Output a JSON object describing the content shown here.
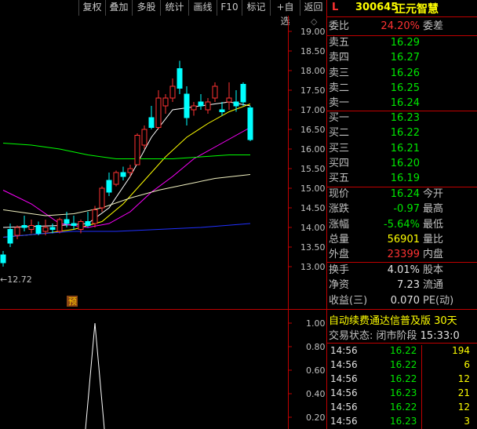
{
  "toolbar": [
    "复权",
    "叠加",
    "多股",
    "统计",
    "画线",
    "F10",
    "标记",
    "+自选",
    "返回"
  ],
  "price_axis": [
    "19.00",
    "18.50",
    "18.00",
    "17.50",
    "17.00",
    "16.50",
    "16.00",
    "15.50",
    "15.00",
    "14.50",
    "14.00",
    "13.50",
    "13.00"
  ],
  "volume_axis": [
    "1.00",
    "0.80",
    "0.60",
    "0.40",
    "0.20"
  ],
  "low_marker": "←12.72",
  "forecast_badge": "预",
  "stock": {
    "flag": "L",
    "code": "300645",
    "name": "正元智慧"
  },
  "weibi": {
    "label": "委比",
    "value": "24.20%",
    "label2": "委差"
  },
  "asks": [
    {
      "label": "卖五",
      "price": "16.29"
    },
    {
      "label": "卖四",
      "price": "16.27"
    },
    {
      "label": "卖三",
      "price": "16.26"
    },
    {
      "label": "卖二",
      "price": "16.25"
    },
    {
      "label": "卖一",
      "price": "16.24"
    }
  ],
  "bids": [
    {
      "label": "买一",
      "price": "16.23"
    },
    {
      "label": "买二",
      "price": "16.22"
    },
    {
      "label": "买三",
      "price": "16.21"
    },
    {
      "label": "买四",
      "price": "16.20"
    },
    {
      "label": "买五",
      "price": "16.19"
    }
  ],
  "quote": [
    {
      "label": "现价",
      "value": "16.24",
      "label2": "今开",
      "color": "g"
    },
    {
      "label": "涨跌",
      "value": "-0.97",
      "label2": "最高",
      "color": "g"
    },
    {
      "label": "涨幅",
      "value": "-5.64%",
      "label2": "最低",
      "color": "g"
    },
    {
      "label": "总量",
      "value": "56901",
      "label2": "量比",
      "color": "y"
    },
    {
      "label": "外盘",
      "value": "23399",
      "label2": "内盘",
      "color": "r"
    }
  ],
  "stats": [
    {
      "label": "换手",
      "value": "4.01%",
      "label2": "股本"
    },
    {
      "label": "净资",
      "value": "7.23",
      "label2": "流通"
    },
    {
      "label": "收益(三)",
      "value": "0.070",
      "label2": "PE(动)"
    }
  ],
  "info_line1": "自动续费通达信普及版 30天",
  "info_line2_label": "交易状态: 闭市阶段",
  "info_line2_time": "15:33:0",
  "ticks": [
    {
      "time": "14:56",
      "price": "16.22",
      "vol": "194"
    },
    {
      "time": "14:56",
      "price": "16.22",
      "vol": "6"
    },
    {
      "time": "14:56",
      "price": "16.22",
      "vol": "12"
    },
    {
      "time": "14:56",
      "price": "16.23",
      "vol": "21"
    },
    {
      "time": "14:56",
      "price": "16.22",
      "vol": "12"
    },
    {
      "time": "14:56",
      "price": "16.23",
      "vol": "3"
    }
  ],
  "candles": [
    {
      "o": 13.3,
      "h": 13.4,
      "l": 13.0,
      "c": 13.1
    },
    {
      "o": 13.95,
      "h": 14.1,
      "l": 13.5,
      "c": 13.6
    },
    {
      "o": 13.8,
      "h": 14.05,
      "l": 13.7,
      "c": 14.0
    },
    {
      "o": 14.05,
      "h": 14.3,
      "l": 13.9,
      "c": 14.0
    },
    {
      "o": 13.95,
      "h": 14.2,
      "l": 13.85,
      "c": 14.05
    },
    {
      "o": 14.05,
      "h": 14.15,
      "l": 13.8,
      "c": 13.85
    },
    {
      "o": 13.9,
      "h": 14.2,
      "l": 13.8,
      "c": 14.0
    },
    {
      "o": 14.0,
      "h": 14.1,
      "l": 13.85,
      "c": 13.95
    },
    {
      "o": 13.9,
      "h": 14.25,
      "l": 13.85,
      "c": 14.2
    },
    {
      "o": 14.2,
      "h": 14.4,
      "l": 14.0,
      "c": 14.1
    },
    {
      "o": 14.1,
      "h": 14.3,
      "l": 13.95,
      "c": 14.05
    },
    {
      "o": 13.95,
      "h": 14.2,
      "l": 13.85,
      "c": 14.15
    },
    {
      "o": 14.15,
      "h": 14.4,
      "l": 14.0,
      "c": 14.05
    },
    {
      "o": 14.1,
      "h": 14.55,
      "l": 14.0,
      "c": 14.45
    },
    {
      "o": 14.5,
      "h": 15.05,
      "l": 14.4,
      "c": 15.0
    },
    {
      "o": 15.2,
      "h": 15.4,
      "l": 14.8,
      "c": 14.9
    },
    {
      "o": 15.1,
      "h": 15.45,
      "l": 15.05,
      "c": 15.4
    },
    {
      "o": 15.4,
      "h": 15.55,
      "l": 15.2,
      "c": 15.3
    },
    {
      "o": 15.4,
      "h": 15.6,
      "l": 15.3,
      "c": 15.5
    },
    {
      "o": 15.6,
      "h": 16.4,
      "l": 15.6,
      "c": 16.35
    },
    {
      "o": 16.1,
      "h": 16.6,
      "l": 16.0,
      "c": 16.5
    },
    {
      "o": 16.8,
      "h": 17.1,
      "l": 16.5,
      "c": 16.55
    },
    {
      "o": 16.55,
      "h": 17.5,
      "l": 16.5,
      "c": 17.3
    },
    {
      "o": 17.1,
      "h": 17.4,
      "l": 16.9,
      "c": 17.3
    },
    {
      "o": 17.3,
      "h": 17.8,
      "l": 17.2,
      "c": 17.6
    },
    {
      "o": 18.05,
      "h": 18.25,
      "l": 17.4,
      "c": 17.55
    },
    {
      "o": 17.4,
      "h": 17.6,
      "l": 16.6,
      "c": 16.8
    },
    {
      "o": 17.0,
      "h": 17.2,
      "l": 16.85,
      "c": 17.1
    },
    {
      "o": 17.2,
      "h": 17.4,
      "l": 17.0,
      "c": 17.1
    },
    {
      "o": 17.0,
      "h": 17.3,
      "l": 16.9,
      "c": 17.2
    },
    {
      "o": 17.3,
      "h": 17.7,
      "l": 17.2,
      "c": 17.6
    },
    {
      "o": 17.0,
      "h": 17.2,
      "l": 16.85,
      "c": 16.95
    },
    {
      "o": 17.2,
      "h": 17.7,
      "l": 17.0,
      "c": 17.3
    },
    {
      "o": 17.2,
      "h": 17.5,
      "l": 16.95,
      "c": 17.1
    },
    {
      "o": 17.65,
      "h": 17.7,
      "l": 17.1,
      "c": 17.2
    },
    {
      "o": 17.05,
      "h": 17.1,
      "l": 16.2,
      "c": 16.24
    }
  ],
  "ma_lines": [
    {
      "color": "#ffffff",
      "points": [
        [
          0,
          14.0
        ],
        [
          8,
          14.05
        ],
        [
          12,
          14.1
        ],
        [
          15,
          14.5
        ],
        [
          18,
          15.3
        ],
        [
          21,
          16.3
        ],
        [
          24,
          17.0
        ],
        [
          28,
          17.1
        ],
        [
          32,
          17.2
        ],
        [
          35,
          17.1
        ]
      ]
    },
    {
      "color": "#ffff00",
      "points": [
        [
          0,
          13.75
        ],
        [
          6,
          13.85
        ],
        [
          10,
          13.95
        ],
        [
          14,
          14.15
        ],
        [
          17,
          14.6
        ],
        [
          20,
          15.2
        ],
        [
          23,
          15.8
        ],
        [
          26,
          16.3
        ],
        [
          29,
          16.65
        ],
        [
          32,
          16.95
        ],
        [
          35,
          17.15
        ]
      ]
    },
    {
      "color": "#ff00ff",
      "points": [
        [
          0,
          14.95
        ],
        [
          4,
          14.6
        ],
        [
          8,
          14.1
        ],
        [
          12,
          14.0
        ],
        [
          15,
          14.1
        ],
        [
          18,
          14.4
        ],
        [
          21,
          14.9
        ],
        [
          24,
          15.3
        ],
        [
          27,
          15.75
        ],
        [
          30,
          16.05
        ],
        [
          33,
          16.35
        ],
        [
          35,
          16.55
        ]
      ]
    },
    {
      "color": "#00ff00",
      "points": [
        [
          0,
          16.15
        ],
        [
          4,
          16.1
        ],
        [
          8,
          16.0
        ],
        [
          12,
          15.85
        ],
        [
          16,
          15.75
        ],
        [
          20,
          15.75
        ],
        [
          24,
          15.75
        ],
        [
          28,
          15.8
        ],
        [
          32,
          15.85
        ],
        [
          35,
          15.85
        ]
      ]
    },
    {
      "color": "#f0f0c0",
      "points": [
        [
          0,
          14.45
        ],
        [
          6,
          14.3
        ],
        [
          10,
          14.35
        ],
        [
          14,
          14.5
        ],
        [
          18,
          14.75
        ],
        [
          22,
          14.95
        ],
        [
          26,
          15.1
        ],
        [
          30,
          15.25
        ],
        [
          35,
          15.35
        ]
      ]
    },
    {
      "color": "#2030ff",
      "points": [
        [
          0,
          13.75
        ],
        [
          6,
          13.85
        ],
        [
          10,
          13.9
        ],
        [
          16,
          13.9
        ],
        [
          22,
          13.95
        ],
        [
          28,
          14.0
        ],
        [
          35,
          14.1
        ]
      ]
    }
  ],
  "volume_spike": {
    "index": 13,
    "value": 1.0
  }
}
